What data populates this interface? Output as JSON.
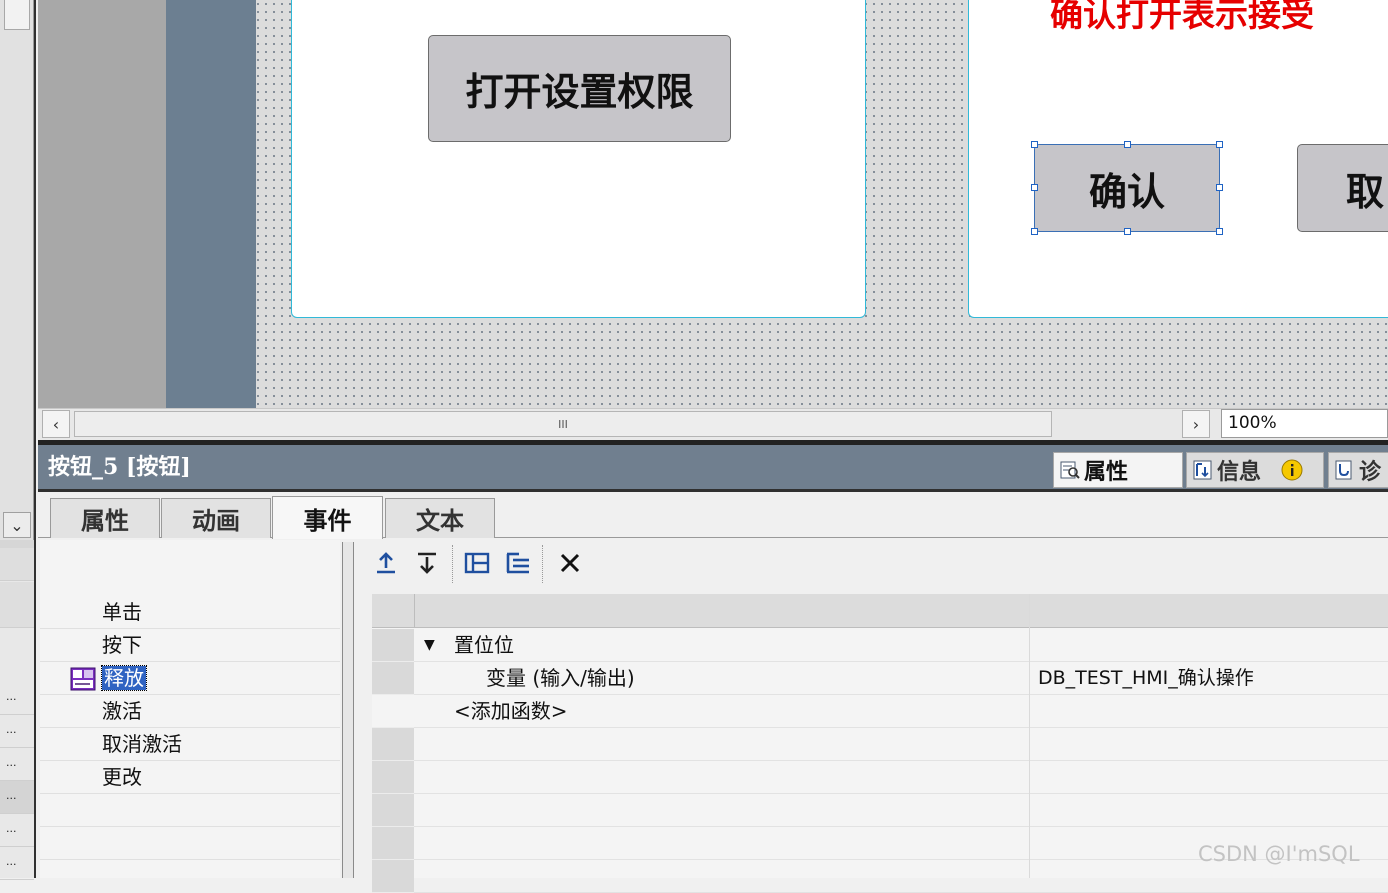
{
  "canvas": {
    "screen1_button_label": "打开设置权限",
    "screen2_title": "确认打开表示接受",
    "confirm_button_label": "确认",
    "cancel_button_label": "取"
  },
  "scrollbar": {
    "thumb_grip": "III",
    "zoom": "100%"
  },
  "inspector": {
    "title": "按钮_5 [按钮]",
    "tabs": [
      {
        "label": "属性"
      },
      {
        "label": "信息"
      },
      {
        "label": "诊"
      }
    ]
  },
  "property_tabs": [
    "属性",
    "动画",
    "事件",
    "文本"
  ],
  "events": [
    "单击",
    "按下",
    "释放",
    "激活",
    "取消激活",
    "更改"
  ],
  "selected_event": "释放",
  "toolbar": {
    "icons": [
      "move-up-icon",
      "move-down-icon",
      "collapse-icon",
      "expand-icon",
      "delete-icon"
    ]
  },
  "function_list": {
    "group": "置位位",
    "param_name": "变量 (输入/输出)",
    "param_value": "DB_TEST_HMI_确认操作",
    "add_function": "<添加函数>"
  },
  "left_strip": {
    "row_marker": "..."
  },
  "watermark": "CSDN @I'mSQL",
  "colors": {
    "accent_blue": "#2f63c2",
    "screen_border": "#31b9d8",
    "title_red": "#e60000",
    "header_bg": "#707f8f"
  }
}
